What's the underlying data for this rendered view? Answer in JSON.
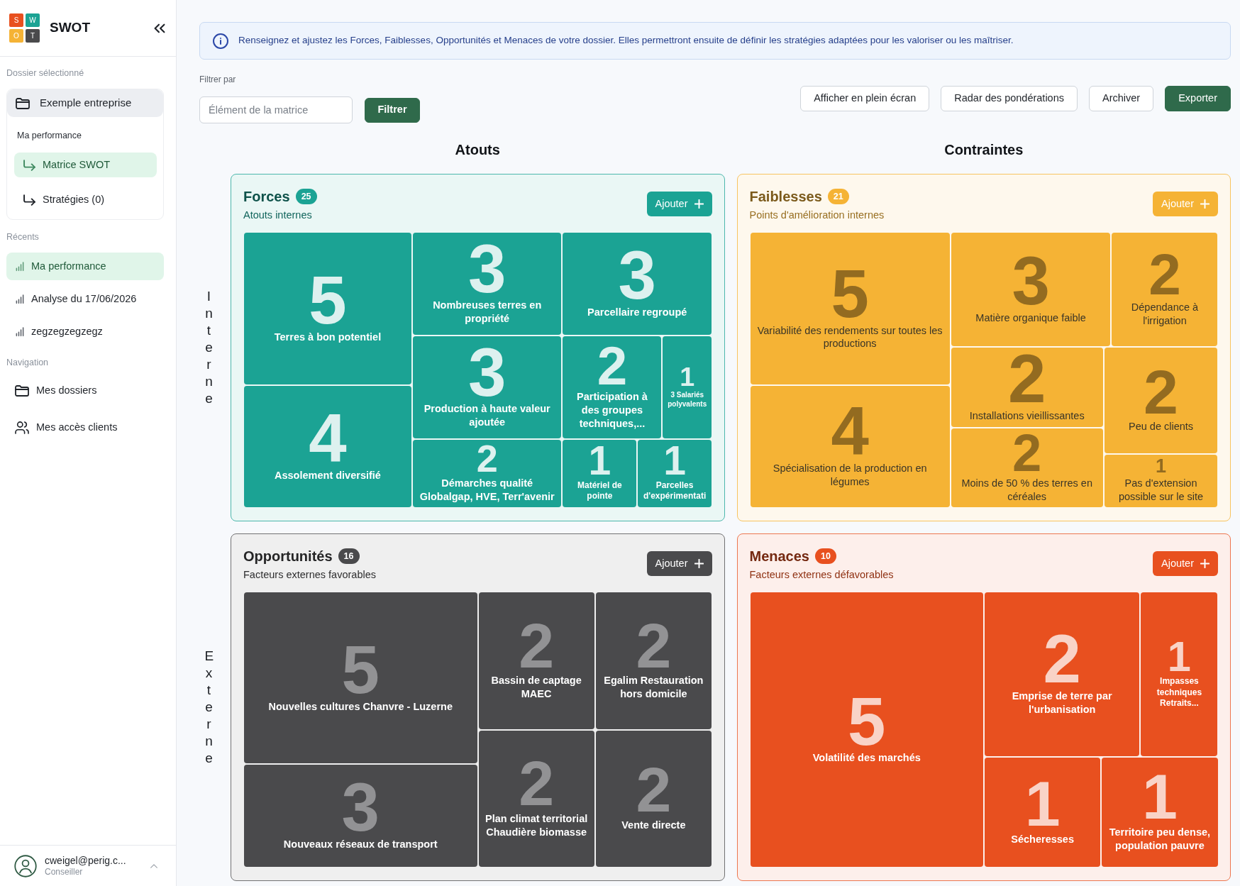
{
  "sidebar": {
    "logo": [
      {
        "letter": "S",
        "color": "#e8501f"
      },
      {
        "letter": "W",
        "color": "#1ba394"
      },
      {
        "letter": "O",
        "color": "#f5b335"
      },
      {
        "letter": "T",
        "color": "#4a4a4c"
      }
    ],
    "app_name": "SWOT",
    "folder": {
      "heading": "Dossier sélectionné",
      "name": "Exemple entreprise",
      "section": "Ma performance",
      "items": [
        {
          "label": "Matrice SWOT",
          "selected": true
        },
        {
          "label": "Stratégies (0)",
          "selected": false
        }
      ]
    },
    "recents": {
      "heading": "Récents",
      "items": [
        {
          "label": "Ma performance",
          "selected": true
        },
        {
          "label": "Analyse du 17/06/2026",
          "selected": false
        },
        {
          "label": "zegzegzegzegz",
          "selected": false
        }
      ]
    },
    "navigation": {
      "heading": "Navigation",
      "items": [
        {
          "label": "Mes dossiers",
          "kind": "folders",
          "selected": false
        },
        {
          "label": "Mes accès clients",
          "kind": "clients",
          "selected": false
        }
      ]
    },
    "user": {
      "email": "cweigel@perig.c...",
      "role": "Conseiller"
    }
  },
  "info_banner": "Renseignez et ajustez les Forces, Faiblesses, Opportunités et Menaces de votre dossier. Elles permettront ensuite de définir les stratégies adaptées pour les valoriser ou les maîtriser.",
  "filter": {
    "label": "Filtrer par",
    "placeholder": "Élément de la matrice",
    "button": "Filtrer"
  },
  "actions": [
    {
      "label": "Afficher en plein écran",
      "kind": "outline"
    },
    {
      "label": "Radar des pondérations",
      "kind": "outline"
    },
    {
      "label": "Archiver",
      "kind": "outline"
    },
    {
      "label": "Exporter",
      "kind": "primary"
    }
  ],
  "matrix": {
    "column_headers": [
      "Atouts",
      "Contraintes"
    ],
    "row_headers": [
      "Interne",
      "Externe"
    ],
    "quadrants": [
      {
        "title": "Forces",
        "count": "25",
        "subtitle": "Atouts internes",
        "color": "#1ba394",
        "add_button": "Ajouter",
        "items": [
          {
            "label": "Terres à bon potentiel",
            "weight": "5"
          },
          {
            "label": "Assolement diversifié",
            "weight": "4"
          },
          {
            "label": "Nombreuses terres en propriété",
            "weight": "3"
          },
          {
            "label": "Parcellaire regroupé",
            "weight": "3"
          },
          {
            "label": "Production à haute valeur ajoutée",
            "weight": "3"
          },
          {
            "label": "Démarches qualité Globalgap, HVE, Terr'avenir",
            "weight": "2"
          },
          {
            "label": "Participation à des groupes techniques,...",
            "weight": "2"
          },
          {
            "label": "3 Salariés polyvalents",
            "weight": "1"
          },
          {
            "label": "Matériel de pointe",
            "weight": "1"
          },
          {
            "label": "Parcelles d'expérimentati",
            "weight": "1"
          }
        ]
      },
      {
        "title": "Faiblesses",
        "count": "21",
        "subtitle": "Points d'amélioration internes",
        "color": "#f5b335",
        "add_button": "Ajouter",
        "items": [
          {
            "label": "Variabilité des rendements sur toutes les productions",
            "weight": "5"
          },
          {
            "label": "Spécialisation de la production en légumes",
            "weight": "4"
          },
          {
            "label": "Matière organique faible",
            "weight": "3"
          },
          {
            "label": "Dépendance à l'irrigation",
            "weight": "2"
          },
          {
            "label": "Installations vieillissantes",
            "weight": "2"
          },
          {
            "label": "Moins de 50 % des terres en céréales",
            "weight": "2"
          },
          {
            "label": "Peu de clients",
            "weight": "2"
          },
          {
            "label": "Pas d'extension possible sur le site",
            "weight": "1"
          }
        ]
      },
      {
        "title": "Opportunités",
        "count": "16",
        "subtitle": "Facteurs externes favorables",
        "color": "#4a4a4c",
        "add_button": "Ajouter",
        "items": [
          {
            "label": "Nouvelles cultures Chanvre - Luzerne",
            "weight": "5"
          },
          {
            "label": "Nouveaux réseaux de transport",
            "weight": "3"
          },
          {
            "label": "Bassin de captage MAEC",
            "weight": "2"
          },
          {
            "label": "Egalim Restauration hors domicile",
            "weight": "2"
          },
          {
            "label": "Plan climat territorial Chaudière biomasse",
            "weight": "2"
          },
          {
            "label": "Vente directe",
            "weight": "2"
          }
        ]
      },
      {
        "title": "Menaces",
        "count": "10",
        "subtitle": "Facteurs externes défavorables",
        "color": "#e8501f",
        "add_button": "Ajouter",
        "items": [
          {
            "label": "Volatilité des marchés",
            "weight": "5"
          },
          {
            "label": "Emprise de terre par l'urbanisation",
            "weight": "2"
          },
          {
            "label": "Impasses techniques Retraits...",
            "weight": "1"
          },
          {
            "label": "Sécheresses",
            "weight": "1"
          },
          {
            "label": "Territoire peu dense, population pauvre",
            "weight": "1"
          }
        ]
      }
    ]
  }
}
